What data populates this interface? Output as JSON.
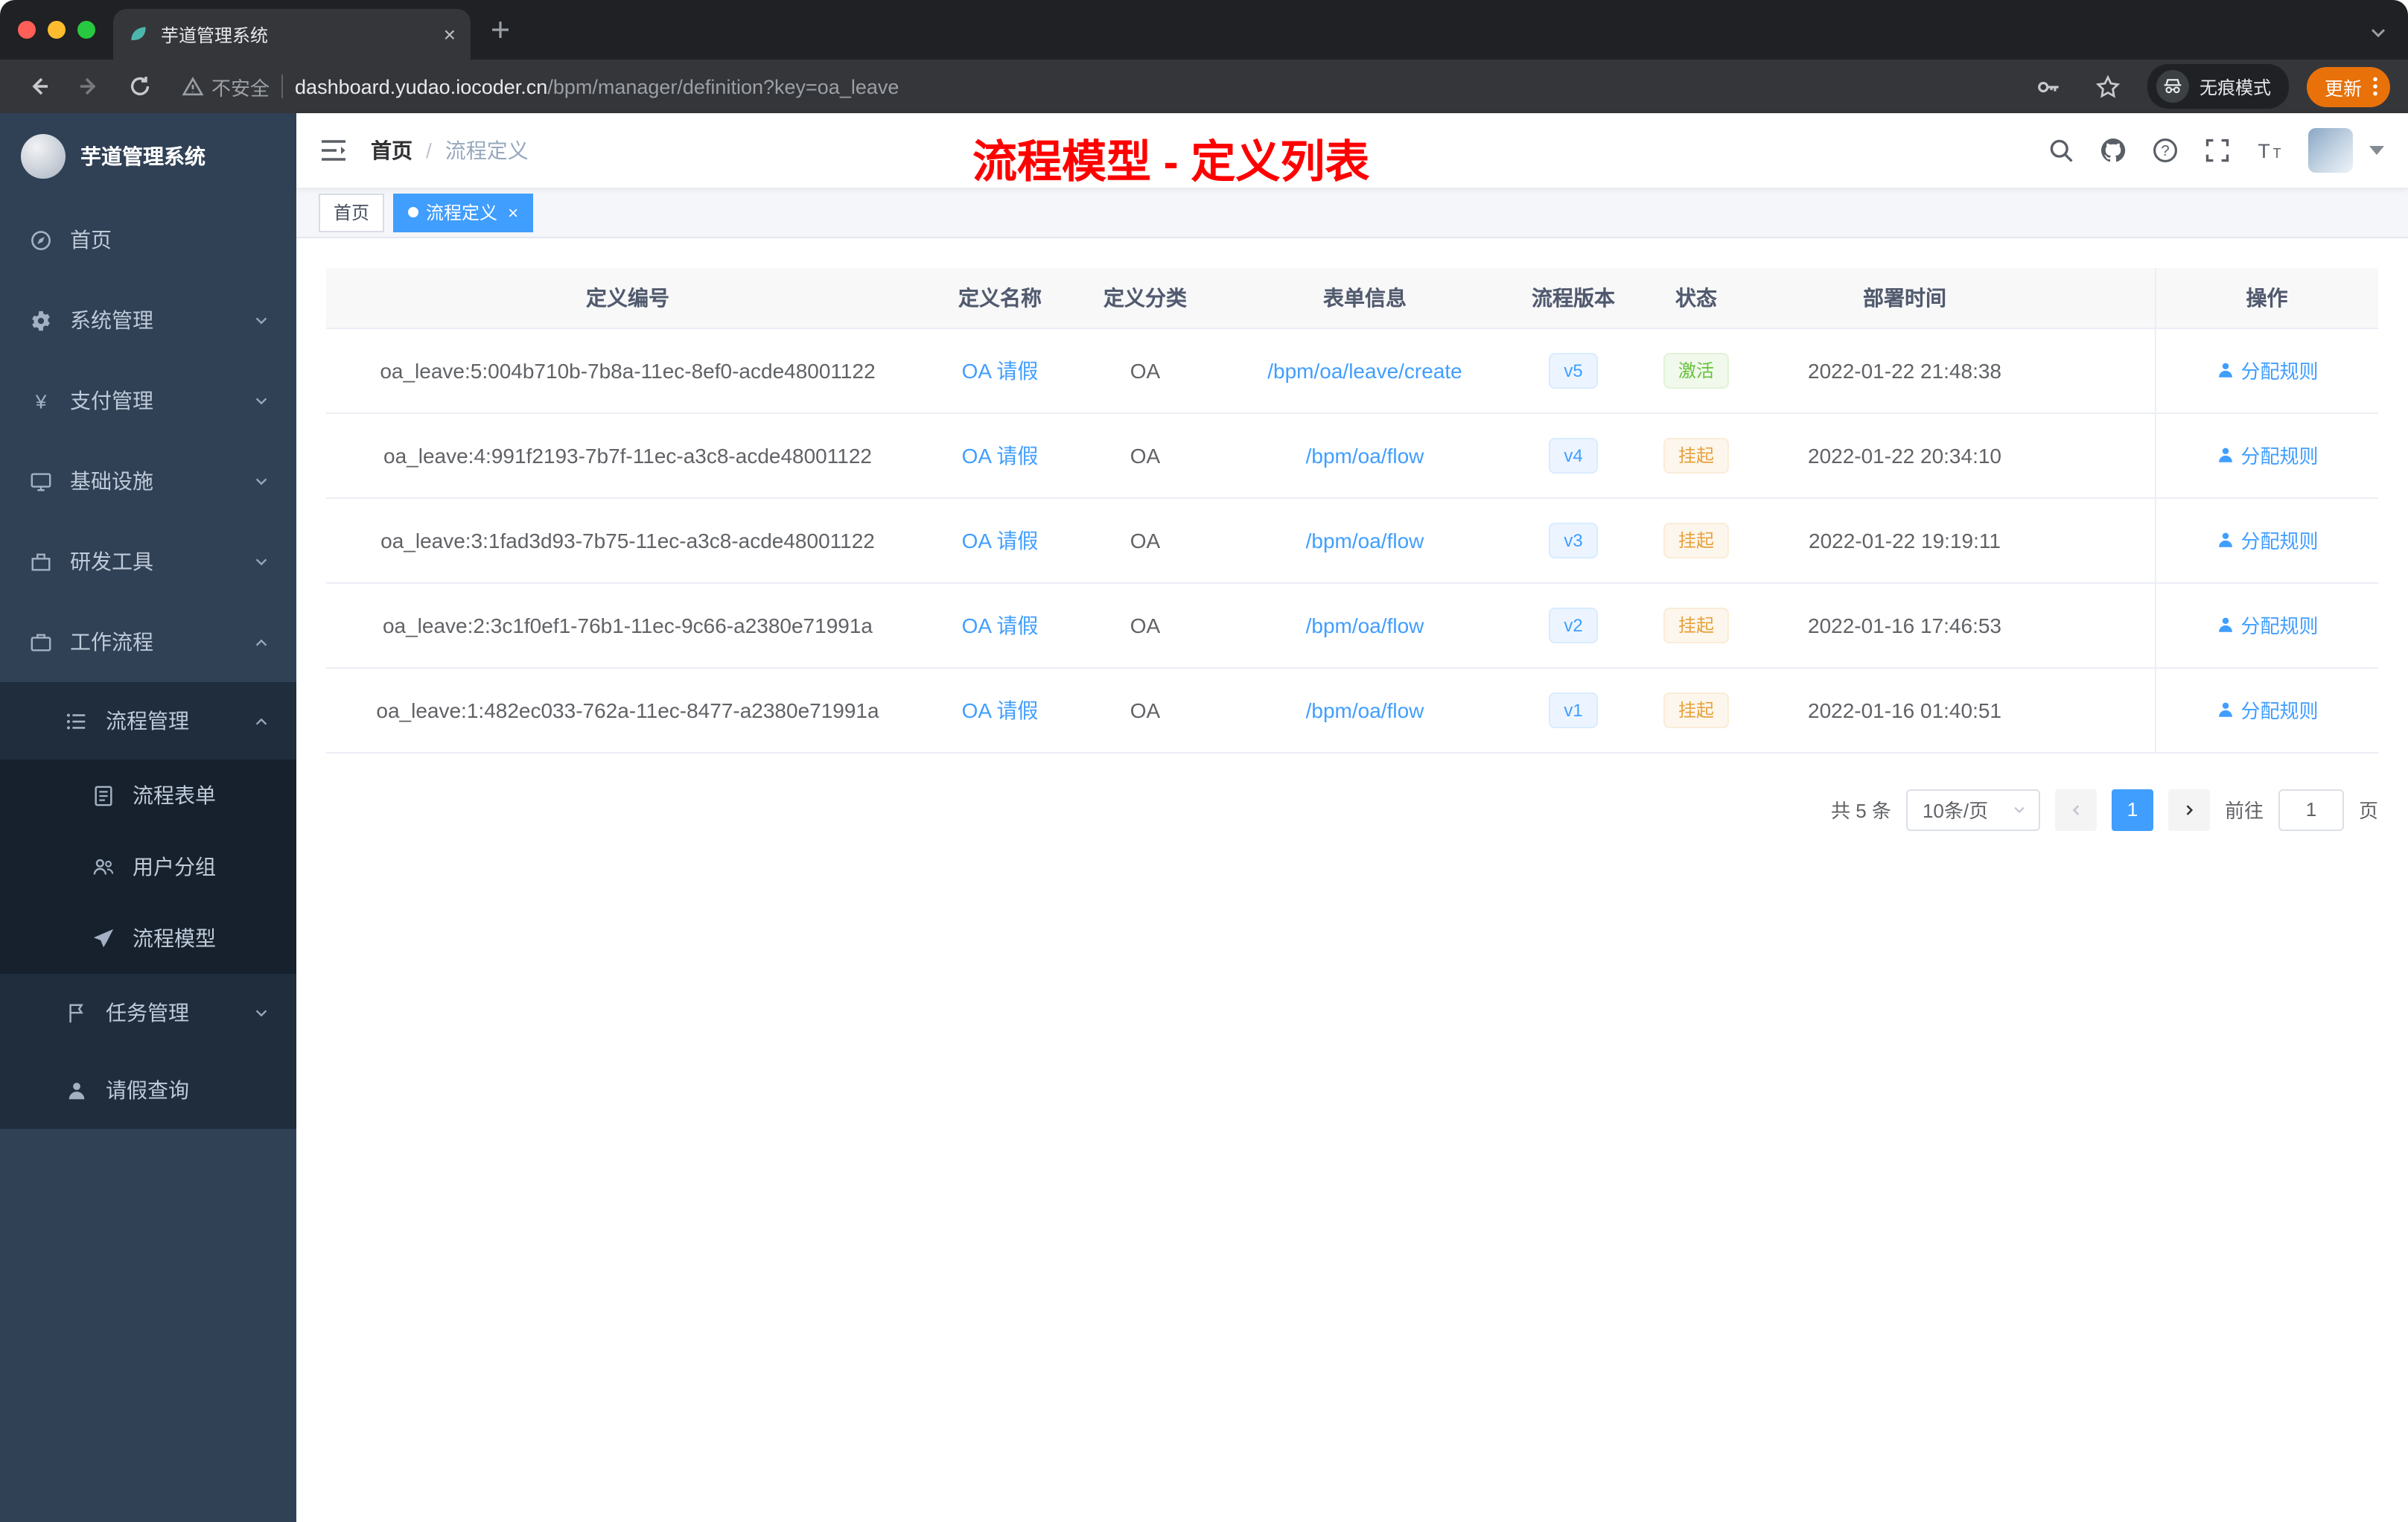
{
  "browser": {
    "tab_title": "芋道管理系统",
    "security_label": "不安全",
    "url_host": "dashboard.yudao.iocoder.cn",
    "url_path": "/bpm/manager/definition?key=oa_leave",
    "incognito_label": "无痕模式",
    "update_label": "更新"
  },
  "sidebar": {
    "logo_title": "芋道管理系统",
    "items": {
      "home": "首页",
      "system": "系统管理",
      "payment": "支付管理",
      "infra": "基础设施",
      "devtools": "研发工具",
      "workflow": "工作流程",
      "process_mgmt": "流程管理",
      "process_form": "流程表单",
      "user_group": "用户分组",
      "process_model": "流程模型",
      "task_mgmt": "任务管理",
      "leave_query": "请假查询"
    }
  },
  "navbar": {
    "breadcrumb_home": "首页",
    "breadcrumb_separator": "/",
    "breadcrumb_current": "流程定义",
    "overlay_title": "流程模型 - 定义列表"
  },
  "tags_view": {
    "home_tag": "首页",
    "active_tag": "流程定义"
  },
  "table": {
    "headers": [
      "定义编号",
      "定义名称",
      "定义分类",
      "表单信息",
      "流程版本",
      "状态",
      "部署时间",
      "操作"
    ],
    "rows": [
      {
        "id": "oa_leave:5:004b710b-7b8a-11ec-8ef0-acde48001122",
        "name": "OA 请假",
        "category": "OA",
        "form": "/bpm/oa/leave/create",
        "version": "v5",
        "status": "激活",
        "time": "2022-01-22 21:48:38",
        "action": "分配规则"
      },
      {
        "id": "oa_leave:4:991f2193-7b7f-11ec-a3c8-acde48001122",
        "name": "OA 请假",
        "category": "OA",
        "form": "/bpm/oa/flow",
        "version": "v4",
        "status": "挂起",
        "time": "2022-01-22 20:34:10",
        "action": "分配规则"
      },
      {
        "id": "oa_leave:3:1fad3d93-7b75-11ec-a3c8-acde48001122",
        "name": "OA 请假",
        "category": "OA",
        "form": "/bpm/oa/flow",
        "version": "v3",
        "status": "挂起",
        "time": "2022-01-22 19:19:11",
        "action": "分配规则"
      },
      {
        "id": "oa_leave:2:3c1f0ef1-76b1-11ec-9c66-a2380e71991a",
        "name": "OA 请假",
        "category": "OA",
        "form": "/bpm/oa/flow",
        "version": "v2",
        "status": "挂起",
        "time": "2022-01-16 17:46:53",
        "action": "分配规则"
      },
      {
        "id": "oa_leave:1:482ec033-762a-11ec-8477-a2380e71991a",
        "name": "OA 请假",
        "category": "OA",
        "form": "/bpm/oa/flow",
        "version": "v1",
        "status": "挂起",
        "time": "2022-01-16 01:40:51",
        "action": "分配规则"
      }
    ]
  },
  "pagination": {
    "total": "共 5 条",
    "page_size": "10条/页",
    "current_page": "1",
    "goto_label": "前往",
    "goto_value": "1",
    "goto_unit": "页"
  },
  "colors": {
    "accent": "#409EFF",
    "success": "#67C23A",
    "warning": "#E6A23C",
    "overlay_red": "#FE0000",
    "update_pill": "#E8710A",
    "sidebar_bg": "#304156",
    "sidebar_sub_bg": "#1F2D3D"
  }
}
